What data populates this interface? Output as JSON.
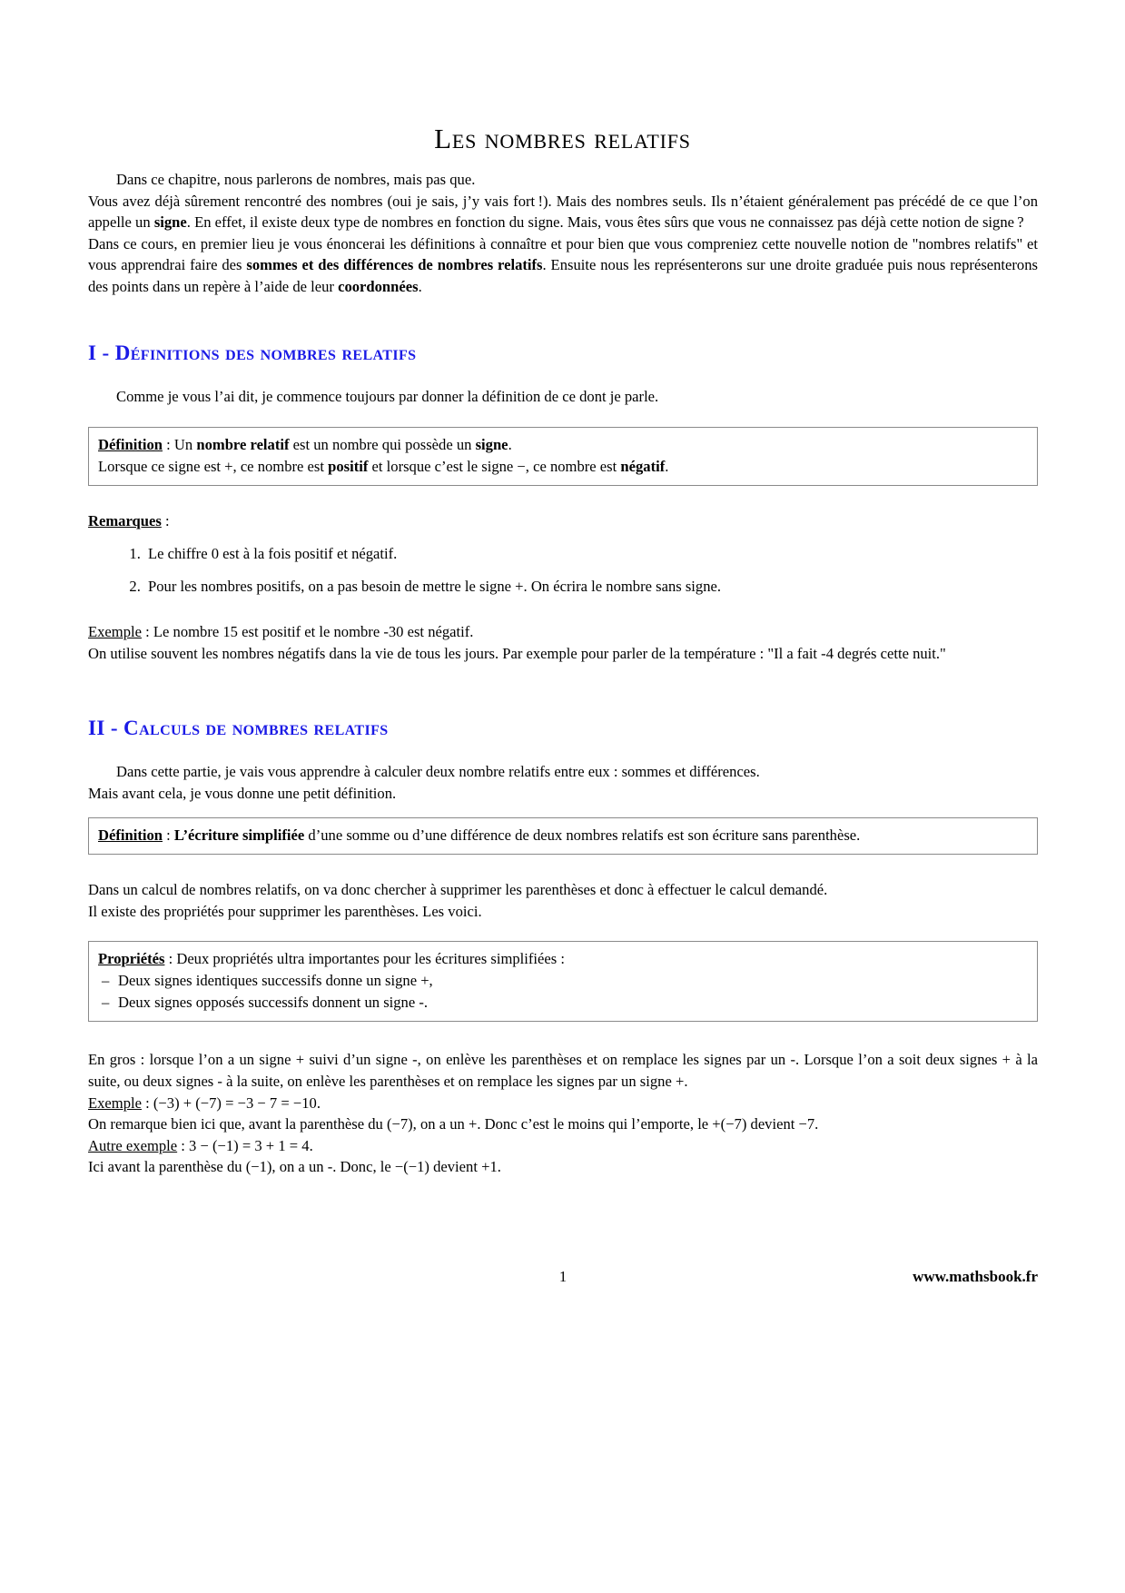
{
  "document": {
    "title": "Les nombres relatifs",
    "accent_color": "#1a1ae6",
    "text_color": "#000000",
    "background_color": "#ffffff"
  },
  "intro": {
    "line1": "Dans ce chapitre, nous parlerons de nombres, mais pas que.",
    "line2_a": "Vous avez déjà sûrement rencontré des nombres (oui je sais, j’y vais fort !). Mais des nombres seuls. Ils n’étaient généralement pas précédé de ce que l’on appelle un ",
    "line2_bold": "signe",
    "line2_b": ". En effet, il existe deux type de nombres en fonction du signe. Mais, vous êtes sûrs que vous ne connaissez pas déjà cette notion de signe ?",
    "para2_a": "Dans ce cours, en premier lieu je vous énoncerai les définitions à connaître et pour bien que vous compreniez cette nouvelle notion de \"nombres relatifs\" et vous apprendrai faire des ",
    "para2_bold1": "sommes et des différences de nombres relatifs",
    "para2_b": ". Ensuite nous les représenterons sur une droite graduée puis nous représenterons des points dans un repère à l’aide de leur ",
    "para2_bold2": "coordonnées",
    "para2_c": "."
  },
  "section1": {
    "heading": "I - Définitions des nombres relatifs",
    "intro": "Comme je vous l’ai dit, je commence toujours par donner la définition de ce dont je parle.",
    "definition_box": {
      "label": "Définition",
      "line1_a": " : Un ",
      "line1_bold": "nombre relatif",
      "line1_b": " est un nombre qui possède un ",
      "line1_bold2": "signe",
      "line1_c": ".",
      "line2_a": "Lorsque ce signe est +, ce nombre est ",
      "line2_bold": "positif",
      "line2_b": " et lorsque c’est le signe −, ce nombre est ",
      "line2_bold2": "négatif",
      "line2_c": "."
    },
    "remarks_label": "Remarques",
    "remarks_colon": " :",
    "remarks": [
      "Le chiffre 0 est à la fois positif et négatif.",
      "Pour les nombres positifs, on a pas besoin de mettre le signe +. On écrira le nombre sans signe."
    ],
    "example_label": "Exemple",
    "example_text": " : Le nombre 15 est positif et le nombre -30 est négatif.",
    "temperature_para": "On utilise souvent les nombres négatifs dans la vie de tous les jours. Par exemple pour parler de la température : \"Il a fait -4 degrés cette nuit.\""
  },
  "section2": {
    "heading": "II - Calculs de nombres relatifs",
    "intro_line1": "Dans cette partie, je vais vous apprendre à calculer deux nombre relatifs entre eux : sommes et différences.",
    "intro_line2": "Mais avant cela, je vous donne une petit définition.",
    "definition_box": {
      "label": "Définition",
      "text_a": " : ",
      "bold": "L’écriture simplifiée",
      "text_b": " d’une somme ou d’une différence de deux nombres relatifs est son écriture sans parenthèse."
    },
    "para_suppr": "Dans un calcul de nombres relatifs, on va donc chercher à supprimer les parenthèses et donc à effectuer le calcul demandé.",
    "para_prop_intro": "Il existe des propriétés pour supprimer les parenthèses. Les voici.",
    "properties_box": {
      "label": "Propriétés",
      "intro": " : Deux propriétés ultra importantes pour les écritures simplifiées :",
      "items": [
        "Deux signes identiques successifs donne un signe +,",
        "Deux signes opposés successifs donnent un signe -."
      ]
    },
    "para_engros": "En gros : lorsque l’on a un signe + suivi d’un signe -, on enlève les parenthèses et on remplace les signes par un -. Lorsque l’on a soit deux signes + à la suite, ou deux signes - à la suite, on enlève les parenthèses et on remplace les signes par un signe +.",
    "example1_label": "Exemple",
    "example1_text": " : (−3) + (−7) = −3 − 7 = −10.",
    "example1_note": "On remarque bien ici que, avant la parenthèse du (−7), on a un +. Donc c’est le moins qui l’emporte, le +(−7) devient −7.",
    "example2_label": "Autre exemple",
    "example2_text": " : 3 − (−1) = 3 + 1 = 4.",
    "example2_note": "Ici avant la parenthèse du (−1), on a un -. Donc, le −(−1) devient +1."
  },
  "footer": {
    "page_number": "1",
    "website": "www.mathsbook.fr"
  }
}
